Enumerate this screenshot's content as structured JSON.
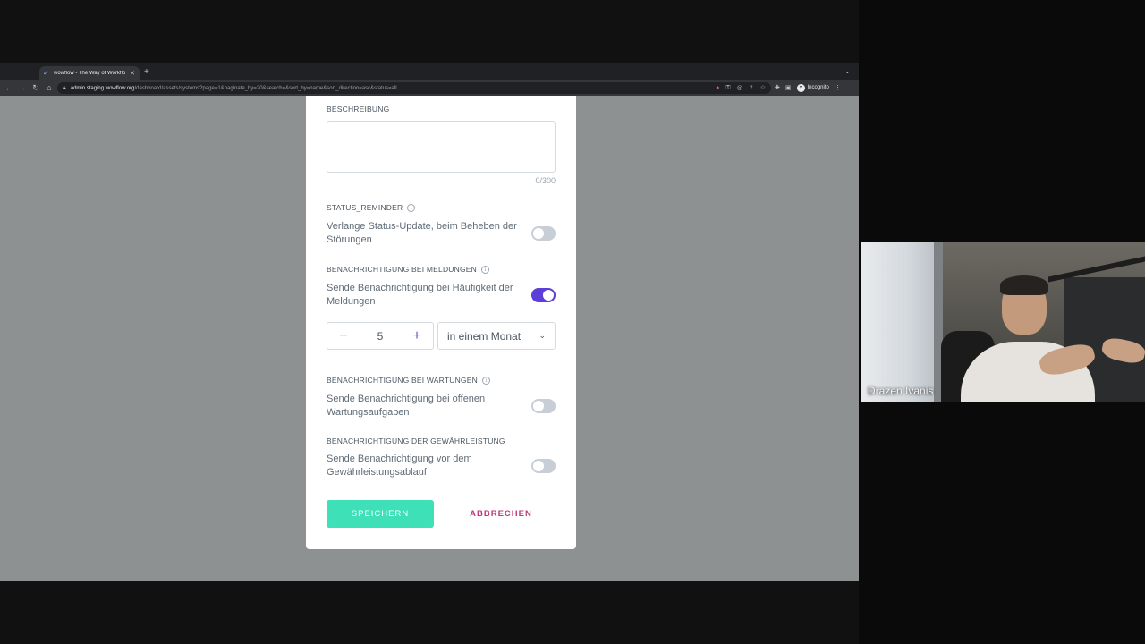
{
  "browser": {
    "tab_title": "wowflow - The Way of Workflo",
    "url_host": "admin.staging.wowflow.org",
    "url_path": "/dashboard/assets/systems?page=1&paginate_by=20&search=&sort_by=name&sort_direction=asc&status=all",
    "incognito_label": "Incognito"
  },
  "form": {
    "beschreibung": {
      "label": "BESCHREIBUNG",
      "value": "",
      "counter": "0/300"
    },
    "status_reminder": {
      "label": "STATUS_REMINDER",
      "text": "Verlange Status-Update, beim Beheben der Störungen",
      "enabled": false
    },
    "meldungen": {
      "label": "BENACHRICHTIGUNG BEI MELDUNGEN",
      "text": "Sende Benachrichtigung bei Häufigkeit der Meldungen",
      "enabled": true,
      "count": "5",
      "period": "in einem Monat"
    },
    "wartungen": {
      "label": "BENACHRICHTIGUNG BEI WARTUNGEN",
      "text": "Sende Benachrichtigung bei offenen Wartungsaufgaben",
      "enabled": false
    },
    "gewaehrleistung": {
      "label": "BENACHRICHTIGUNG DER GEWÄHRLEISTUNG",
      "text": "Sende Benachrichtigung vor dem Gewährleistungsablauf",
      "enabled": false
    },
    "save_label": "SPEICHERN",
    "cancel_label": "ABBRECHEN"
  },
  "video": {
    "participant_name": "Drazen Ivanis"
  },
  "colors": {
    "accent_purple": "#5c3fd6",
    "save_green": "#3de0b7",
    "cancel_pink": "#c4357a"
  }
}
